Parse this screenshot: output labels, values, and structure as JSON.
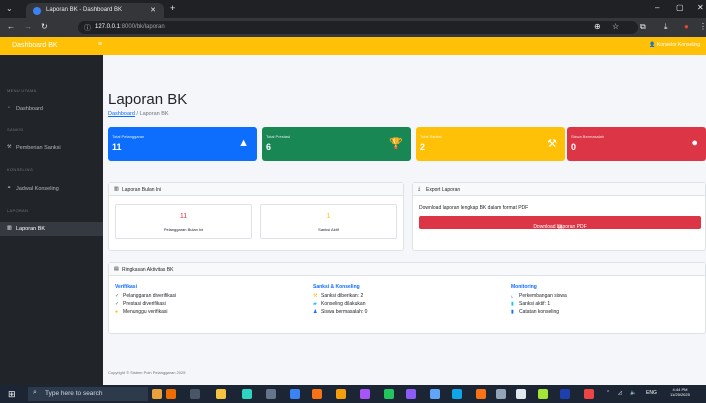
{
  "browser": {
    "tab_title": "Laporan BK - Dashboard BK",
    "url_host": "127.0.0.1",
    "url_path": ":8000/bk/laporan"
  },
  "topbar": {
    "brand": "Dashboard BK",
    "user": "Konselor Konseling"
  },
  "sidebar": {
    "headings": {
      "main": "MENU UTAMA",
      "sanksi": "SANKSI",
      "konseling": "KONSELING",
      "laporan": "LAPORAN"
    },
    "items": [
      {
        "label": "Dashboard",
        "icon": "speedometer-icon"
      },
      {
        "label": "Pemberian Sanksi",
        "icon": "gavel-icon"
      },
      {
        "label": "Jadwal Konseling",
        "icon": "handshake-icon"
      },
      {
        "label": "Laporan BK",
        "icon": "chart-icon",
        "active": true
      }
    ]
  },
  "page": {
    "title": "Laporan BK",
    "breadcrumb_link": "Dashboard",
    "breadcrumb_current": " / Laporan BK"
  },
  "stats": [
    {
      "label": "Total Pelanggaran",
      "value": "11",
      "color": "#0d6efd",
      "icon": "warning-icon"
    },
    {
      "label": "Total Prestasi",
      "value": "6",
      "color": "#198754",
      "icon": "trophy-icon"
    },
    {
      "label": "Total Sanksi",
      "value": "2",
      "color": "#ffc107",
      "icon": "gavel-icon"
    },
    {
      "label": "Siswa Bermasalah",
      "value": "0",
      "color": "#dc3545",
      "icon": "alert-icon"
    }
  ],
  "monthly": {
    "header": "Laporan Bulan Ini",
    "violations_value": "11",
    "violations_label": "Pelanggaran Bulan Ini",
    "sanctions_value": "1",
    "sanctions_label": "Sanksi Aktif"
  },
  "export": {
    "header": "Export Laporan",
    "text": "Download laporan lengkap BK dalam format PDF",
    "button": "Download Laporan PDF"
  },
  "summary": {
    "header": "Ringkasan Aktivitas BK",
    "columns": [
      {
        "title": "Verifikasi",
        "rows": [
          {
            "icon": "check-icon",
            "text": "Pelanggaran diverifikasi"
          },
          {
            "icon": "check-icon",
            "text": "Prestasi diverifikasi"
          },
          {
            "icon": "clock-icon",
            "text": "Menunggu verifikasi"
          }
        ]
      },
      {
        "title": "Sanksi & Konseling",
        "rows": [
          {
            "icon": "gavel-icon",
            "text": "Sanksi diberikan: 2"
          },
          {
            "icon": "chat-icon",
            "text": "Konseling dilakukan"
          },
          {
            "icon": "users-icon",
            "text": "Siswa bermasalah: 0"
          }
        ]
      },
      {
        "title": "Monitoring",
        "rows": [
          {
            "icon": "trend-icon",
            "text": "Perkembangan siswa"
          },
          {
            "icon": "file-icon",
            "text": "Sanksi aktif: 1"
          },
          {
            "icon": "note-icon",
            "text": "Catatan konseling"
          }
        ]
      }
    ]
  },
  "footer": "Copyright © Sistem Poin Pelanggaran 2025",
  "taskbar": {
    "search_placeholder": "Type here to search",
    "time": "4:44 PM",
    "date": "11/25/2025"
  }
}
